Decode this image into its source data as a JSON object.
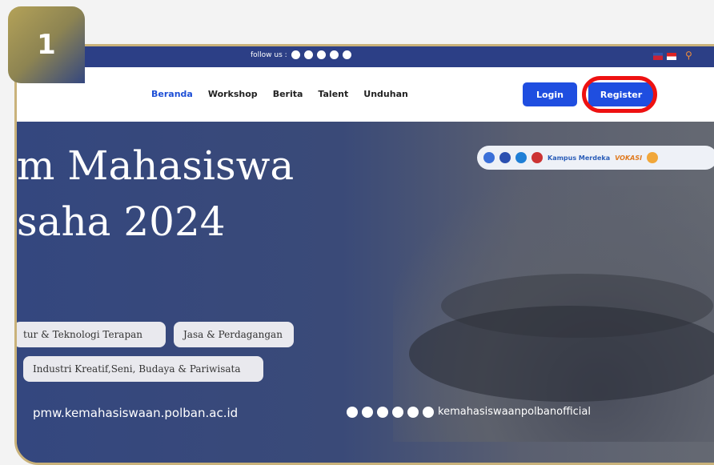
{
  "step_badge": "1",
  "topbar": {
    "follow_label": "follow us :",
    "social_icons": [
      "instagram-icon",
      "facebook-icon",
      "youtube-icon",
      "whatsapp-icon",
      "telegram-icon"
    ]
  },
  "nav": {
    "items": [
      "Beranda",
      "Workshop",
      "Berita",
      "Talent",
      "Unduhan"
    ],
    "login_label": "Login",
    "register_label": "Register"
  },
  "hero": {
    "title_line1": "m Mahasiswa",
    "title_line2": "saha 2024",
    "pills": [
      "tur & Teknologi Terapan",
      "Jasa & Perdagangan",
      "Industri Kreatif,Seni, Budaya & Pariwisata"
    ],
    "partner_logos": [
      "Kampus Merdeka",
      "VOKASI"
    ],
    "website": "pmw.kemahasiswaan.polban.ac.id",
    "social_handle": "kemahasiswaanpolbanofficial"
  },
  "colors": {
    "accent": "#1f4ee0",
    "highlight_ring": "#e11111",
    "badge_gold": "#b4a258"
  }
}
